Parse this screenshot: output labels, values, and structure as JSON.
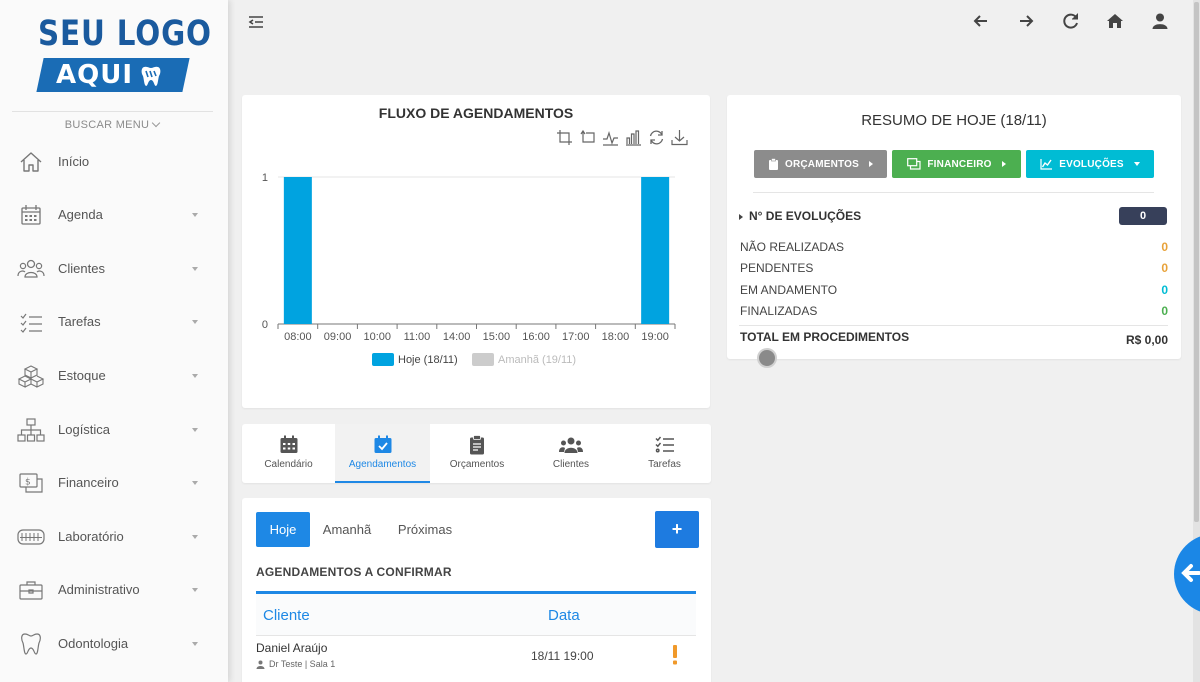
{
  "logo": {
    "line1": "SEU LOGO",
    "line2": "AQUI"
  },
  "sidebar": {
    "search_menu": "BUSCAR MENU",
    "items": [
      {
        "label": "Início",
        "icon": "home-icon"
      },
      {
        "label": "Agenda",
        "icon": "calendar-icon"
      },
      {
        "label": "Clientes",
        "icon": "users-icon"
      },
      {
        "label": "Tarefas",
        "icon": "tasks-icon"
      },
      {
        "label": "Estoque",
        "icon": "boxes-icon"
      },
      {
        "label": "Logística",
        "icon": "sitemap-icon"
      },
      {
        "label": "Financeiro",
        "icon": "money-icon"
      },
      {
        "label": "Laboratório",
        "icon": "denture-icon"
      },
      {
        "label": "Administrativo",
        "icon": "briefcase-icon"
      },
      {
        "label": "Odontologia",
        "icon": "tooth-icon"
      }
    ]
  },
  "topbar": {
    "icons": [
      "menu-collapse-icon",
      "arrow-left-icon",
      "arrow-right-icon",
      "refresh-icon",
      "home-icon",
      "user-icon"
    ]
  },
  "chart_card": {
    "title": "FLUXO DE AGENDAMENTOS",
    "tools": [
      "zoom-icon",
      "zoom-reset-icon",
      "line-chart-icon",
      "bar-chart-icon",
      "restore-icon",
      "download-icon"
    ]
  },
  "chart_data": {
    "type": "bar",
    "title": "FLUXO DE AGENDAMENTOS",
    "categories": [
      "08:00",
      "09:00",
      "10:00",
      "11:00",
      "14:00",
      "15:00",
      "16:00",
      "17:00",
      "18:00",
      "19:00"
    ],
    "series": [
      {
        "name": "Hoje (18/11)",
        "values": [
          1,
          0,
          0,
          0,
          0,
          0,
          0,
          0,
          0,
          1
        ],
        "color": "#00a3e0"
      },
      {
        "name": "Amanhã (19/11)",
        "values": [
          0,
          0,
          0,
          0,
          0,
          0,
          0,
          0,
          0,
          0
        ],
        "color": "#cccccc"
      }
    ],
    "ylim": [
      0,
      1
    ],
    "yticks": [
      0,
      1
    ],
    "legend": "bottom",
    "grid": true
  },
  "resumo": {
    "title": "RESUMO DE HOJE (18/11)",
    "buttons": {
      "orcamentos": {
        "label": "ORÇAMENTOS",
        "color": "#8c8c8c"
      },
      "financeiro": {
        "label": "FINANCEIRO",
        "color": "#4caf50"
      },
      "evolucoes": {
        "label": "EVOLUÇÕES",
        "color": "#00bcd4"
      }
    },
    "evolucoes_label": "N° DE EVOLUÇÕES",
    "evolucoes_count": "0",
    "stats": [
      {
        "label": "NÃO REALIZADAS",
        "value": "0",
        "color": "#e8a23a"
      },
      {
        "label": "PENDENTES",
        "value": "0",
        "color": "#e8a23a"
      },
      {
        "label": "EM ANDAMENTO",
        "value": "0",
        "color": "#00bcd4"
      },
      {
        "label": "FINALIZADAS",
        "value": "0",
        "color": "#4caf50"
      }
    ],
    "total_label": "TOTAL EM PROCEDIMENTOS",
    "total_value": "R$ 0,00"
  },
  "tabs": [
    {
      "label": "Calendário",
      "icon": "calendar-icon"
    },
    {
      "label": "Agendamentos",
      "icon": "calendar-check-icon",
      "active": true
    },
    {
      "label": "Orçamentos",
      "icon": "clipboard-icon"
    },
    {
      "label": "Clientes",
      "icon": "users-icon"
    },
    {
      "label": "Tarefas",
      "icon": "tasks-icon"
    }
  ],
  "agendamentos": {
    "filters": {
      "today": "Hoje",
      "tomorrow": "Amanhã",
      "next": "Próximas"
    },
    "add_label": "+",
    "section_title": "AGENDAMENTOS A CONFIRMAR",
    "columns": {
      "client": "Cliente",
      "date": "Data"
    },
    "rows": [
      {
        "client": "Daniel Araújo",
        "sub": "Dr Teste | Sala 1",
        "date": "18/11 19:00"
      }
    ]
  },
  "colors": {
    "accent": "#1e88e5",
    "brand": "#1a6cb5",
    "badge": "#37405a"
  }
}
